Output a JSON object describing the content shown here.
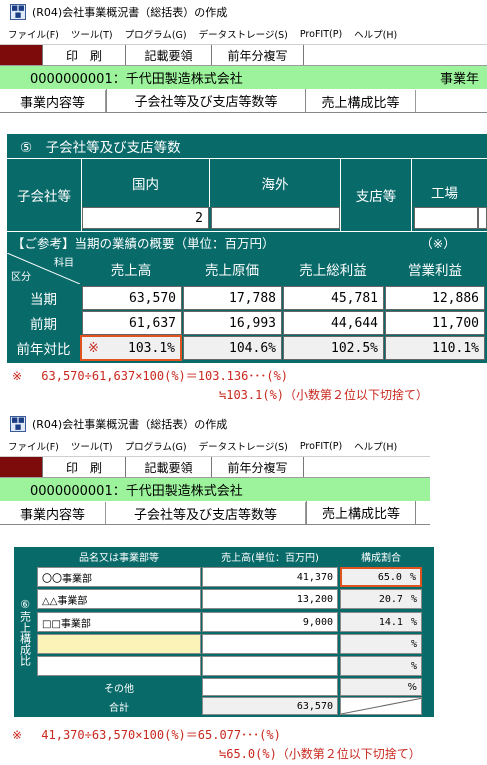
{
  "window1": {
    "title": "(R04)会社事業概況書（総括表）の作成",
    "menu": [
      "ファイル(F)",
      "ツール(T)",
      "プログラム(G)",
      "データストレージ(S)",
      "ProFIT(P)",
      "ヘルプ(H)"
    ],
    "toolbar": [
      "印　刷",
      "記載要領",
      "前年分複写"
    ],
    "company": "0000000001：千代田製造株式会社",
    "company_right": "事業年",
    "tabs": [
      "事業内容等",
      "子会社等及び支店等数等",
      "売上構成比等"
    ],
    "section_title": "⑤　子会社等及び支店等数",
    "sub_label": "子会社等",
    "domestic": "国内",
    "overseas": "海外",
    "branch": "支店等",
    "factory": "工場",
    "domestic_value": "2",
    "reference": "【ご参考】当期の業績の概要（単位：百万円）",
    "reference_mark": "（※）",
    "corner_top": "科目",
    "corner_bottom": "区分",
    "columns": [
      "売上高",
      "売上原価",
      "売上総利益",
      "営業利益"
    ],
    "rows": [
      {
        "label": "当期",
        "values": [
          "63,570",
          "17,788",
          "45,781",
          "12,886"
        ]
      },
      {
        "label": "前期",
        "values": [
          "61,637",
          "16,993",
          "44,644",
          "11,700"
        ]
      },
      {
        "label": "前年対比",
        "mark": "※",
        "values": [
          "103.1%",
          "104.6%",
          "102.5%",
          "110.1%"
        ]
      }
    ]
  },
  "note1": {
    "line1": "※　 63,570÷61,637×100(%)＝103.136･･･(%)",
    "line2": "≒103.1(%)（小数第２位以下切捨て）"
  },
  "window2": {
    "title": "(R04)会社事業概況書（総括表）の作成",
    "menu": [
      "ファイル(F)",
      "ツール(T)",
      "プログラム(G)",
      "データストレージ(S)",
      "ProFIT(P)",
      "ヘルプ(H)"
    ],
    "toolbar": [
      "印　刷",
      "記載要領",
      "前年分複写"
    ],
    "company": "0000000001：千代田製造株式会社",
    "tabs": [
      "事業内容等",
      "子会社等及び支店等数等",
      "売上構成比等"
    ],
    "side_label": "⑥売上構成比",
    "headers": [
      "品名又は事業部等",
      "売上高(単位：百万円)",
      "構成割合"
    ],
    "rows": [
      {
        "name": "〇〇事業部",
        "sales": "41,370",
        "ratio": "65.0",
        "pct": "%"
      },
      {
        "name": "△△事業部",
        "sales": "13,200",
        "ratio": "20.7",
        "pct": "%"
      },
      {
        "name": "□□事業部",
        "sales": "9,000",
        "ratio": "14.1",
        "pct": "%"
      },
      {
        "name": "",
        "sales": "",
        "ratio": "",
        "pct": "%"
      },
      {
        "name": "",
        "sales": "",
        "ratio": "",
        "pct": "%"
      }
    ],
    "other_label": "その他",
    "other_pct": "%",
    "total_label": "合計",
    "total_value": "63,570"
  },
  "note2": {
    "line1": "※　 41,370÷63,570×100(%)＝65.077･･･(%)",
    "line2": "≒65.0(%)（小数第２位以下切捨て）"
  },
  "colors": {
    "accent_teal": "#096a6a",
    "company_green": "#9cf39c",
    "highlight_orange": "#e0531f",
    "note_red": "#c8281e"
  }
}
